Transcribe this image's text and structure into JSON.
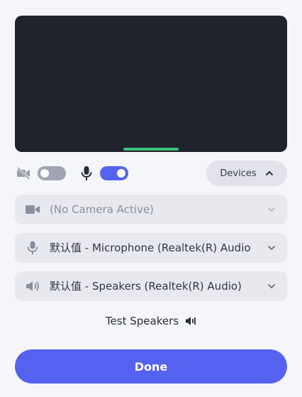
{
  "preview": {
    "audio_level_color": "#3ec07a"
  },
  "controls": {
    "camera_toggle_on": false,
    "mic_toggle_on": true,
    "devices_label": "Devices"
  },
  "selects": {
    "camera": "(No Camera Active)",
    "microphone": "默认值 - Microphone (Realtek(R) Audio)",
    "speakers": "默认值 - Speakers (Realtek(R) Audio)"
  },
  "test_speakers_label": "Test Speakers",
  "done_label": "Done",
  "colors": {
    "accent": "#5562f0",
    "preview_bg": "#20222c",
    "audio_level": "#3ec07a"
  }
}
